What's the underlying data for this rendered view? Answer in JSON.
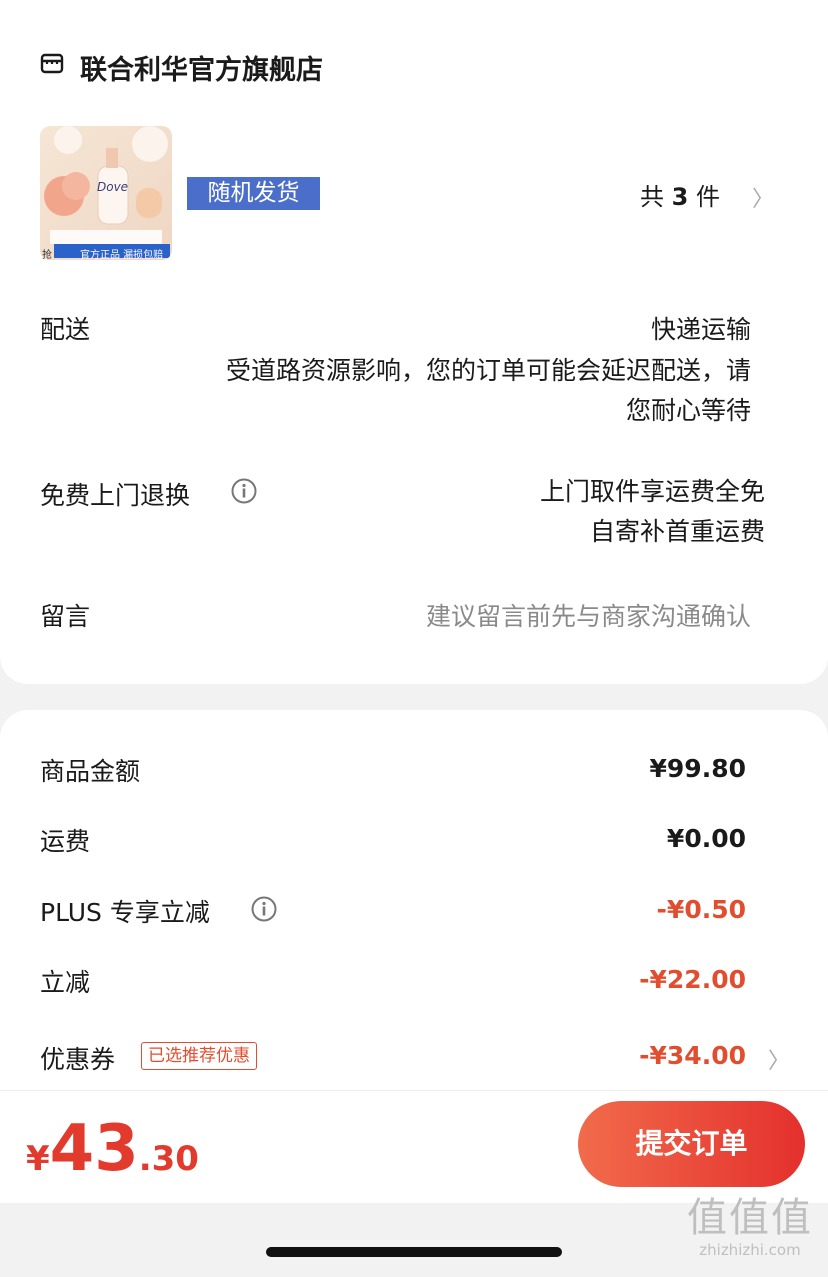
{
  "store": {
    "name": "联合利华官方旗舰店",
    "icon": "store-icon"
  },
  "product": {
    "thumb_brand": "Dove",
    "thumb_caption": "官方正品 漏损包赔",
    "thumb_corner": "抢",
    "tag": "随机发货",
    "qty_prefix": "共",
    "qty_count": "3",
    "qty_suffix": "件",
    "chevron": "〉"
  },
  "delivery": {
    "label": "配送",
    "method": "快递运输",
    "notice_line1": "受道路资源影响，您的订单可能会延迟配送，请",
    "notice_line2": "您耐心等待"
  },
  "returns": {
    "label": "免费上门退换",
    "line1": "上门取件享运费全免",
    "line2": "自寄补首重运费"
  },
  "message": {
    "label": "留言",
    "placeholder": "建议留言前先与商家沟通确认"
  },
  "summary": {
    "goods_label": "商品金额",
    "goods_value": "¥99.80",
    "shipping_label": "运费",
    "shipping_value": "¥0.00",
    "plus_label": "PLUS 专享立减",
    "plus_value": "-¥0.50",
    "discount_label": "立减",
    "discount_value": "-¥22.00",
    "coupon_label": "优惠券",
    "coupon_badge": "已选推荐优惠",
    "coupon_value": "-¥34.00",
    "chevron": "〉"
  },
  "footer": {
    "currency": "¥",
    "total_int": "43",
    "total_dec": ".30",
    "submit_label": "提交订单"
  },
  "watermark": {
    "big": "值值值",
    "small": "zhizhizhi.com"
  },
  "colors": {
    "accent_red": "#e04d2f",
    "tag_blue": "#4b6ecb",
    "button_start": "#f16b4b",
    "button_end": "#e4302d"
  }
}
